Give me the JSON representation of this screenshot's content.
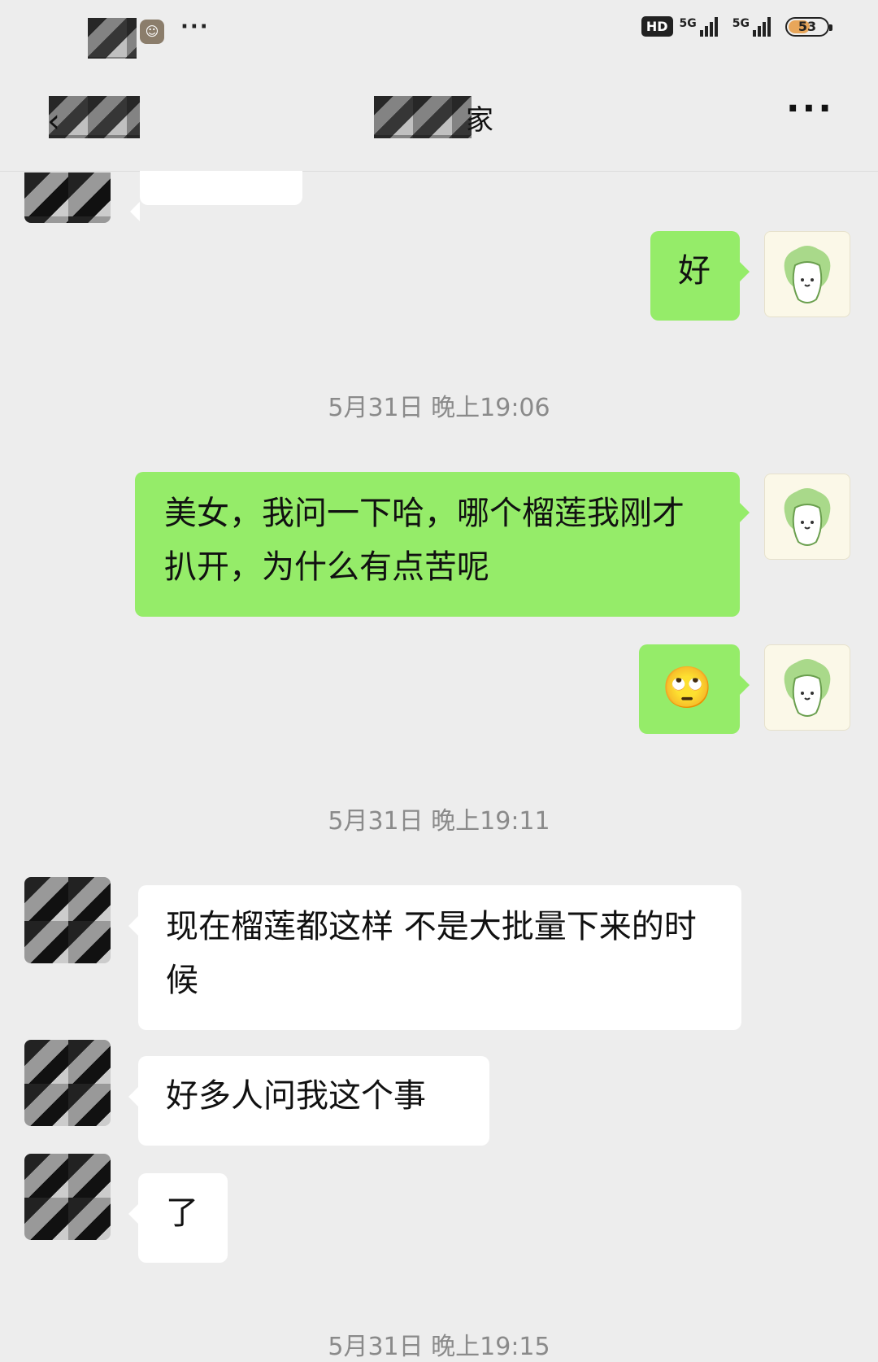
{
  "status_bar": {
    "hd_label": "HD",
    "sim1_label": "5G",
    "sim2_label": "5G",
    "battery_level": "53",
    "more_dots": "···"
  },
  "header": {
    "back_icon": "‹",
    "title": "家",
    "more_label": "···"
  },
  "messages": [
    {
      "side": "out",
      "text": "好"
    },
    {
      "side": "time",
      "text": "5月31日 晚上19:06"
    },
    {
      "side": "out",
      "text": "美女，我问一下哈，哪个榴莲我刚才扒开，为什么有点苦呢"
    },
    {
      "side": "out",
      "text": "🙄"
    },
    {
      "side": "time",
      "text": "5月31日 晚上19:11"
    },
    {
      "side": "in",
      "text": "现在榴莲都这样 不是大批量下来的时候"
    },
    {
      "side": "in",
      "text": "好多人问我这个事"
    },
    {
      "side": "in",
      "text": "了"
    },
    {
      "side": "time",
      "text": "5月31日 晚上19:15"
    }
  ],
  "colors": {
    "outgoing_bubble": "#95ec69",
    "incoming_bubble": "#ffffff",
    "background": "#ededed"
  },
  "icons": {
    "self_avatar": "cabbage-sticker-icon",
    "emoji": "flushed-face-icon"
  }
}
